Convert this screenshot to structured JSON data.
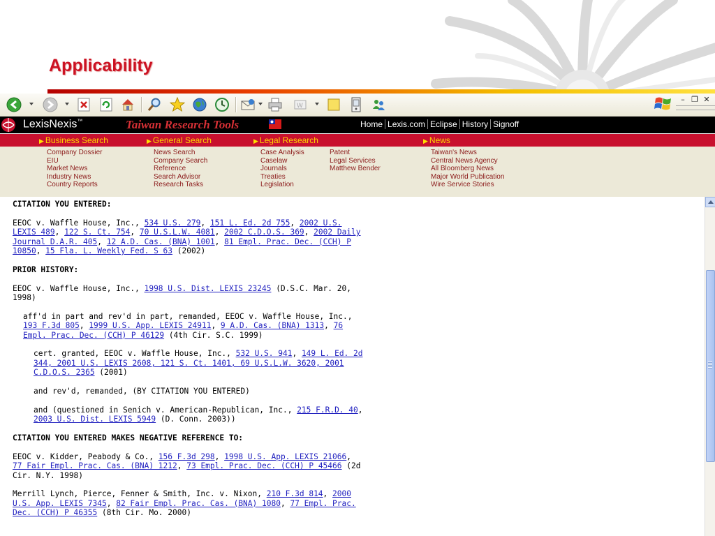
{
  "slide": {
    "title": "Applicability"
  },
  "window_controls": {
    "minimize": "–",
    "restore": "❐",
    "close": "✕"
  },
  "lexis": {
    "brand": "LexisNexis",
    "brand_mark": "™",
    "subtitle": "Taiwan Research Tools",
    "top_nav": [
      "Home",
      "Lexis.com",
      "Eclipse",
      "History",
      "Signoff"
    ]
  },
  "categories": [
    "Business Search",
    "General Search",
    "Legal Research",
    "News"
  ],
  "menus": {
    "business": [
      "Company Dossier",
      "EIU",
      "Market News",
      "Industry News",
      "Country Reports"
    ],
    "general": [
      "News Search",
      "Company Search",
      "Reference",
      "Search Advisor",
      "Research Tasks"
    ],
    "legal_a": [
      "Case Analysis",
      "Caselaw",
      "Journals",
      "Treaties",
      "Legislation"
    ],
    "legal_b": [
      "Patent",
      "Legal Services",
      "Matthew Bender"
    ],
    "news": [
      "Taiwan's News",
      "Central News Agency",
      "All Bloomberg News",
      "Major World Publication",
      "Wire Service Stories"
    ]
  },
  "doc": {
    "h_entered": "CITATION YOU ENTERED:",
    "p1": {
      "t0": "EEOC v. Waffle House, Inc., ",
      "l1": "534 U.S. 279",
      "s1": ", ",
      "l2": "151 L. Ed. 2d 755",
      "s2": ", ",
      "l3": "2002 U.S. LEXIS 489",
      "s3": ", ",
      "l4": "122 S. Ct. 754",
      "s4": ", ",
      "l5": "70 U.S.L.W. 4081",
      "s5": ", ",
      "l6": "2002 C.D.O.S. 369",
      "s6": ", ",
      "l7": "2002 Daily Journal D.A.R. 405",
      "s7": ", ",
      "l8": "12 A.D. Cas. (BNA) 1001",
      "s8": ", ",
      "l9": "81 Empl. Prac. Dec. (CCH) P 10850",
      "s9": ", ",
      "l10": "15 Fla. L. Weekly Fed. S 63",
      "t_end": " (2002)"
    },
    "h_prior": "PRIOR HISTORY:",
    "p2": {
      "t0": "EEOC v. Waffle House, Inc., ",
      "l1": "1998 U.S. Dist. LEXIS 23245",
      "t_end": " (D.S.C. Mar. 20, 1998)"
    },
    "p3": {
      "t0": "aff'd in part and rev'd in part, remanded, EEOC v. Waffle House, Inc., ",
      "l1": "193 F.3d 805",
      "s1": ", ",
      "l2": "1999 U.S. App. LEXIS 24911",
      "s2": ", ",
      "l3": "9 A.D. Cas. (BNA) 1313",
      "s3": ", ",
      "l4": "76 Empl. Prac. Dec. (CCH) P 46129",
      "t_end": " (4th Cir. S.C. 1999)"
    },
    "p4": {
      "t0": "cert. granted, EEOC v. Waffle House, Inc., ",
      "l1": "532 U.S. 941",
      "s1": ", ",
      "l2": "149 L. Ed. 2d 344, 2001 U.S. LEXIS 2608, 121 S. Ct. 1401, 69 U.S.L.W. 3620, 2001 C.D.O.S. 2365",
      "t_end": " (2001)"
    },
    "p5": "and rev'd, remanded, (BY CITATION YOU ENTERED)",
    "p6": {
      "t0": "and (questioned in Senich v. American-Republican, Inc., ",
      "l1": "215 F.R.D. 40",
      "s1": ", ",
      "l2": "2003 U.S. Dist. LEXIS 5949",
      "t_end": " (D. Conn. 2003))"
    },
    "h_negative": "CITATION YOU ENTERED MAKES NEGATIVE REFERENCE TO:",
    "p7": {
      "t0": "EEOC v. Kidder, Peabody & Co., ",
      "l1": "156 F.3d 298",
      "s1": ", ",
      "l2": "1998 U.S. App. LEXIS 21066",
      "s2": ", ",
      "l3": "77 Fair Empl. Prac. Cas. (BNA) 1212",
      "s3": ", ",
      "l4": "73 Empl. Prac. Dec. (CCH) P 45466",
      "t_end": " (2d Cir. N.Y. 1998)"
    },
    "p8": {
      "t0": "Merrill Lynch, Pierce, Fenner & Smith, Inc. v. Nixon, ",
      "l1": "210 F.3d 814",
      "s1": ", ",
      "l2": "2000 U.S. App. LEXIS 7345",
      "s2": ", ",
      "l3": "82 Fair Empl. Prac. Cas. (BNA) 1080",
      "s3": ", ",
      "l4": "77 Empl. Prac. Dec. (CCH) P 46355",
      "t_end": " (8th Cir. Mo. 2000)"
    }
  },
  "colors": {
    "title": "#cc1222",
    "nav_red": "#c8102e",
    "category": "#ffd700",
    "menu_text": "#8b1a1a",
    "link": "#1f1fbf"
  }
}
